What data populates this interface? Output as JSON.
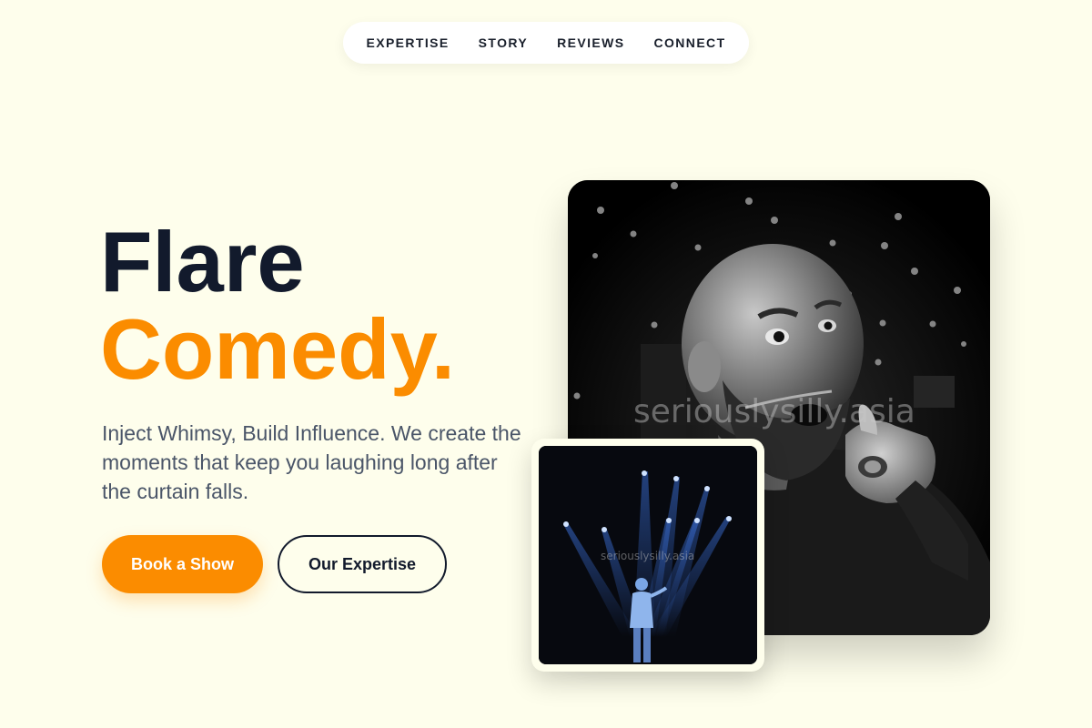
{
  "nav": {
    "items": [
      {
        "label": "EXPERTISE"
      },
      {
        "label": "STORY"
      },
      {
        "label": "REVIEWS"
      },
      {
        "label": "CONNECT"
      }
    ]
  },
  "hero": {
    "title_line1": "Flare",
    "title_line2": "Comedy.",
    "subtitle": "Inject Whimsy, Build Influence. We create the moments that keep you laughing long after the curtain falls.",
    "primary_button": "Book a Show",
    "secondary_button": "Our Expertise"
  },
  "images": {
    "main_watermark": "seriouslysilly.asia",
    "small_watermark": "seriouslysilly.asia"
  },
  "colors": {
    "background": "#fefeec",
    "accent": "#fb8c00",
    "dark": "#121a2c",
    "text_muted": "#4a5568"
  }
}
